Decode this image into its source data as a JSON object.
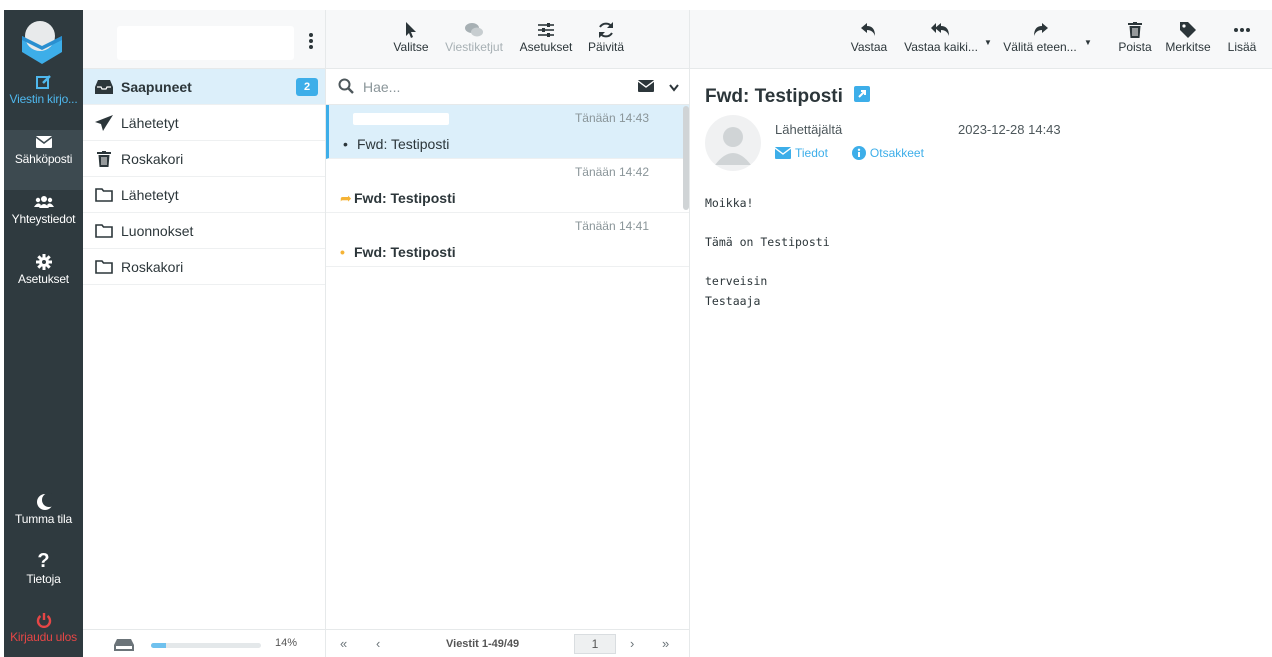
{
  "rail": {
    "compose": "Viestin kirjo...",
    "mail": "Sähköposti",
    "contacts": "Yhteystiedot",
    "settings": "Asetukset",
    "dark_mode": "Tumma tila",
    "about": "Tietoja",
    "logout": "Kirjaudu ulos"
  },
  "folders": {
    "items": [
      {
        "label": "Saapuneet",
        "icon": "inbox-icon",
        "badge": "2",
        "selected": true
      },
      {
        "label": "Lähetetyt",
        "icon": "paper-plane-icon"
      },
      {
        "label": "Roskakori",
        "icon": "trash-icon"
      },
      {
        "label": "Lähetetyt",
        "icon": "folder-icon"
      },
      {
        "label": "Luonnokset",
        "icon": "folder-icon"
      },
      {
        "label": "Roskakori",
        "icon": "folder-icon"
      }
    ],
    "quota_percent": 14,
    "quota_text": "14%"
  },
  "list_toolbar": {
    "select": "Valitse",
    "threads": "Viestiketjut",
    "options": "Asetukset",
    "refresh": "Päivitä"
  },
  "search": {
    "placeholder": "Hae..."
  },
  "messages": [
    {
      "date": "Tänään 14:43",
      "subject": "Fwd: Testiposti",
      "marker": "•",
      "bold": false,
      "selected": true
    },
    {
      "date": "Tänään 14:42",
      "subject": "Fwd: Testiposti",
      "marker": "➦",
      "bold": true,
      "selected": false
    },
    {
      "date": "Tänään 14:41",
      "subject": "Fwd: Testiposti",
      "marker": "•",
      "bold": true,
      "selected": false
    }
  ],
  "pagination": {
    "count": "Viestit 1-49/49",
    "page": "1"
  },
  "reader_toolbar": {
    "reply": "Vastaa",
    "reply_all": "Vastaa kaiki...",
    "forward": "Välitä eteen...",
    "delete": "Poista",
    "mark": "Merkitse",
    "more": "Lisää"
  },
  "reader": {
    "subject": "Fwd: Testiposti",
    "sender_label": "Lähettäjältä",
    "date": "2023-12-28 14:43",
    "details_link": "Tiedot",
    "headers_link": "Otsakkeet",
    "body": [
      "Moikka!",
      "",
      "Tämä on Testiposti",
      "",
      "terveisin",
      "Testaaja"
    ]
  },
  "colors": {
    "accent": "#3daee9",
    "rail": "#2f3a3f",
    "logout": "#e64646",
    "selected_bg": "#dceffa"
  }
}
